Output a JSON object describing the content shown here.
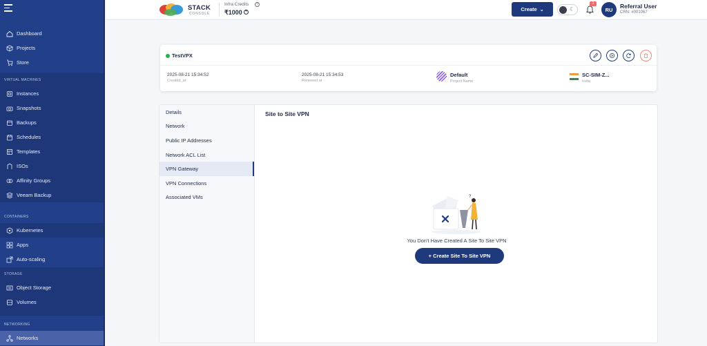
{
  "sidebar": {
    "top_items": [
      {
        "label": "Dashboard",
        "icon": "home-icon"
      },
      {
        "label": "Projects",
        "icon": "cube-icon"
      },
      {
        "label": "Store",
        "icon": "store-icon"
      }
    ],
    "sections": [
      {
        "title": "VIRTUAL MACHINES",
        "items": [
          {
            "label": "Instances",
            "icon": "instances-icon"
          },
          {
            "label": "Snapshots",
            "icon": "camera-icon"
          },
          {
            "label": "Backups",
            "icon": "backup-icon"
          },
          {
            "label": "Schedules",
            "icon": "schedule-icon"
          },
          {
            "label": "Templates",
            "icon": "template-icon"
          },
          {
            "label": "ISOs",
            "icon": "iso-icon"
          },
          {
            "label": "Affinity Groups",
            "icon": "affinity-icon"
          },
          {
            "label": "Veeam Backup",
            "icon": "veeam-icon"
          }
        ]
      },
      {
        "title": "CONTAINERS",
        "items": [
          {
            "label": "Kubernetes",
            "icon": "kubernetes-icon"
          },
          {
            "label": "Apps",
            "icon": "apps-icon"
          },
          {
            "label": "Auto-scaling",
            "icon": "autoscale-icon"
          }
        ]
      },
      {
        "title": "STORAGE",
        "items": [
          {
            "label": "Object Storage",
            "icon": "object-storage-icon"
          },
          {
            "label": "Volumes",
            "icon": "volume-icon"
          }
        ]
      },
      {
        "title": "NETWORKING",
        "items": [
          {
            "label": "Networks",
            "icon": "network-icon"
          }
        ]
      }
    ]
  },
  "topbar": {
    "brand": "STACK",
    "brand_sub": "CONSOLE",
    "credits_label": "Infra Credits",
    "credits_value": "₹1000",
    "create_label": "Create",
    "notification_count": "1",
    "avatar_initials": "RU",
    "user_name": "Referral User",
    "user_crn": "CRN: #001067"
  },
  "instance": {
    "name": "TestVPX",
    "status_color": "#22b24c",
    "created_at_value": "2025-08-21 15:34:52",
    "created_at_label": "Created_at",
    "renewed_at_value": "2025-08-21 15:34:53",
    "renewed_at_label": "Renewed at",
    "project_value": "Default",
    "project_label": "Project Name",
    "region_value": "SC-SIM-Z...",
    "region_label": "India"
  },
  "details": {
    "tabs": [
      "Details",
      "Network",
      "Public IP Addresses",
      "Network ACL List",
      "VPN Gateway",
      "VPN Connections",
      "Associated VMs"
    ],
    "active_tab": "VPN Gateway",
    "title": "Site to Site VPN",
    "empty_message": "You Don't Have Created A Site To Site VPN",
    "create_button": "+ Create Site To Site VPN"
  },
  "colors": {
    "sidebar": "#22408a",
    "primary": "#1e3a7c",
    "danger": "#ef8a7a"
  }
}
